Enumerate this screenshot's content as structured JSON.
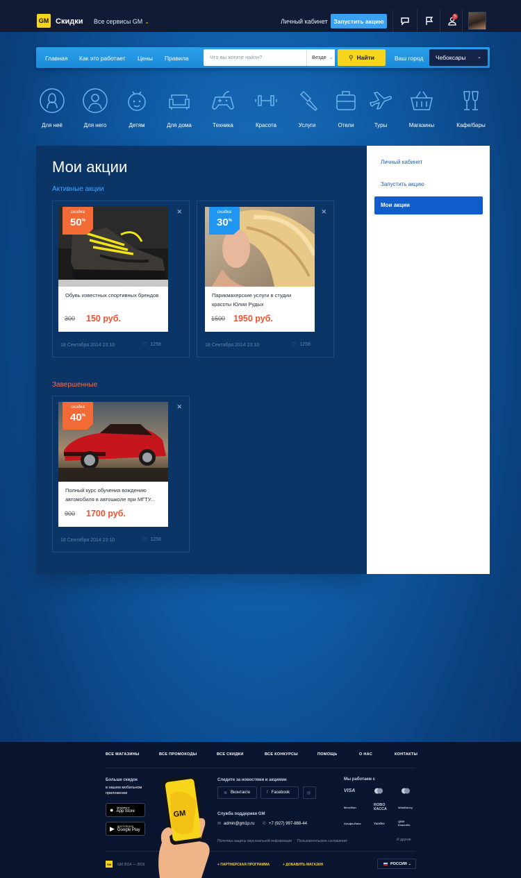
{
  "header": {
    "logo_text": "GM",
    "brand": "Скидки",
    "services": "Все сервисы GM",
    "cabinet_link": "Личный кабинет",
    "launch_button": "Запустить акцию",
    "notifications_count": "5",
    "accent_color": "#3aa0f0"
  },
  "nav": {
    "links": [
      "Главная",
      "Как это работает",
      "Цены",
      "Правила"
    ],
    "search_placeholder": "Что вы хотите найти?",
    "scope": "Везде",
    "find_button": "Найти",
    "city_label": "Ваш город",
    "city": "Чебоксары"
  },
  "categories": [
    {
      "label": "Для неё",
      "icon": "woman-icon"
    },
    {
      "label": "Для него",
      "icon": "man-icon"
    },
    {
      "label": "Детям",
      "icon": "kids-icon"
    },
    {
      "label": "Для дома",
      "icon": "sofa-icon"
    },
    {
      "label": "Техника",
      "icon": "gamepad-icon"
    },
    {
      "label": "Красота",
      "icon": "dumbbell-icon"
    },
    {
      "label": "Услуги",
      "icon": "hammer-icon"
    },
    {
      "label": "Отели",
      "icon": "suitcase-icon"
    },
    {
      "label": "Туры",
      "icon": "plane-icon"
    },
    {
      "label": "Магазины",
      "icon": "basket-icon"
    },
    {
      "label": "Кафе/бары",
      "icon": "glasses-icon"
    }
  ],
  "page": {
    "title": "Мои акции",
    "active_section": "Активные акции",
    "completed_section": "Завершенные"
  },
  "sidebar": {
    "items": [
      "Личный кабинет",
      "Запустить акцию",
      "Мои акции"
    ],
    "active": "Мои акции"
  },
  "cards_active": [
    {
      "badge_label": "скидка",
      "discount": "50",
      "percent": "%",
      "badge_color": "#f26a35",
      "description": "Обувь известных спортивных брендов",
      "old_price": "300",
      "new_price": "150 руб.",
      "date": "18 Сентября 2014 23:10",
      "likes": "1258",
      "image": "sneaker-photo"
    },
    {
      "badge_label": "скидка",
      "discount": "30",
      "percent": "%",
      "badge_color": "#1f96f2",
      "description": "Парикмахерские услуги в студии красоты Юлии Рудых",
      "old_price": "1500",
      "new_price": "1950 руб.",
      "date": "18 Сентября 2014 23:10",
      "likes": "1258",
      "image": "hair-model-photo"
    }
  ],
  "cards_completed": [
    {
      "badge_label": "скидка",
      "discount": "40",
      "percent": "%",
      "badge_color": "#f26a35",
      "description": "Полный курс обучения вождению автомобиля в автошколе при МГТУ...",
      "old_price": "900",
      "new_price": "1700 руб.",
      "date": "18 Сентября 2014 23:10",
      "likes": "1258",
      "image": "red-car-photo"
    }
  ],
  "footer": {
    "nav": [
      "ВСЕ МАГАЗИНЫ",
      "ВСЕ ПРОМОКОДЫ",
      "ВСЕ СКИДКИ",
      "ВСЕ КОНКУРСЫ",
      "ПОМОЩЬ",
      "О НАС",
      "КОНТАКТЫ"
    ],
    "app_title": "Больше скидок",
    "app_sub": "в нашем мобильном приложении",
    "app_store_small": "Загрузите в",
    "app_store": "App Store",
    "google_play_small": "ДОСТУПНО В",
    "google_play": "Google Play",
    "news_title": "Следите за новостями и акциями",
    "vk": "Вконтакте",
    "fb": "Facebook",
    "support_title": "Служба поддержки GM",
    "email": "admin@gm1p.ru",
    "phone": "+7 (927) 997-888-44",
    "privacy": "Политика защиты персональной информации",
    "agreement": "Пользовательское соглашение",
    "partners_title": "Мы работаем с",
    "partners": [
      "VISA",
      "МегаФон",
      "ROBO КАССА",
      "WebMoney",
      "Альфа-Банк",
      "Yandex",
      "QIWI Кошелёк"
    ],
    "and_others": "И другие",
    "copyright": "GM 2014 — 2019",
    "partner_program": "+ ПАРТНЕРСКАЯ ПРОГРАММА",
    "add_shop": "+ ДОБАВИТЬ МАГАЗИН",
    "country": "РОССИЯ",
    "phone_logo": "GM"
  }
}
